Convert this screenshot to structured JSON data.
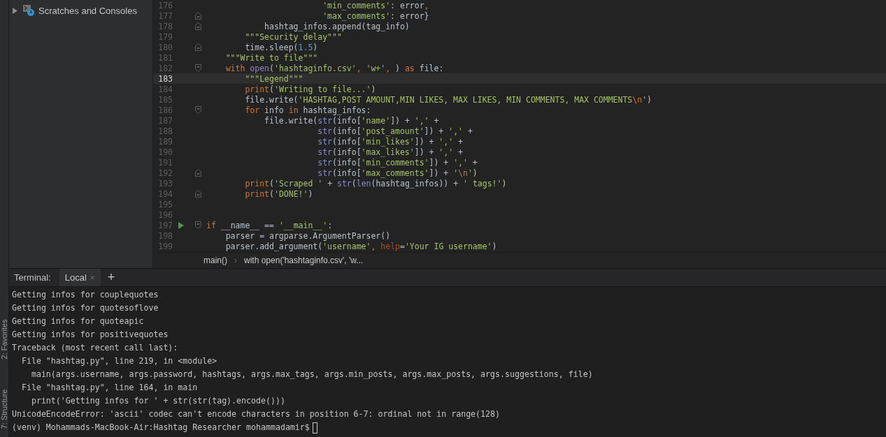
{
  "project_tree": {
    "items": [
      {
        "label": "Scratches and Consoles",
        "expanded": false
      }
    ]
  },
  "tool_strip": {
    "items": [
      {
        "label": "2: Favorites"
      },
      {
        "label": "7: Structure"
      }
    ]
  },
  "editor": {
    "lines": [
      {
        "number": "176",
        "fold_start": false,
        "fold_end": false,
        "run": false,
        "current": false,
        "tokens": [
          {
            "kind": "str",
            "text": "                        'min_comments'"
          },
          {
            "kind": "plain",
            "text": ": error"
          },
          {
            "kind": "kw",
            "text": ","
          }
        ]
      },
      {
        "number": "177",
        "fold_start": false,
        "fold_end": true,
        "run": false,
        "current": false,
        "tokens": [
          {
            "kind": "str",
            "text": "                        'max_comments'"
          },
          {
            "kind": "plain",
            "text": ": error}"
          }
        ]
      },
      {
        "number": "178",
        "fold_start": false,
        "fold_end": true,
        "run": false,
        "current": false,
        "tokens": [
          {
            "kind": "plain",
            "text": "            hashtag_infos.append(tag_info)"
          }
        ]
      },
      {
        "number": "179",
        "fold_start": false,
        "fold_end": false,
        "run": false,
        "current": false,
        "tokens": [
          {
            "kind": "doc",
            "text": "        \"\"\"Security delay\"\"\""
          }
        ]
      },
      {
        "number": "180",
        "fold_start": false,
        "fold_end": true,
        "run": false,
        "current": false,
        "tokens": [
          {
            "kind": "plain",
            "text": "        time.sleep("
          },
          {
            "kind": "num",
            "text": "1.5"
          },
          {
            "kind": "plain",
            "text": ")"
          }
        ]
      },
      {
        "number": "181",
        "fold_start": false,
        "fold_end": false,
        "run": false,
        "current": false,
        "tokens": [
          {
            "kind": "doc",
            "text": "    \"\"\"Write to file\"\"\""
          }
        ]
      },
      {
        "number": "182",
        "fold_start": true,
        "fold_end": false,
        "run": false,
        "current": false,
        "tokens": [
          {
            "kind": "kw",
            "text": "    with "
          },
          {
            "kind": "fn",
            "text": "open"
          },
          {
            "kind": "plain",
            "text": "("
          },
          {
            "kind": "str",
            "text": "'hashtaginfo.csv'"
          },
          {
            "kind": "kw",
            "text": ", "
          },
          {
            "kind": "str",
            "text": "'w+'"
          },
          {
            "kind": "kw",
            "text": ", "
          },
          {
            "kind": "plain",
            "text": ") "
          },
          {
            "kind": "kw",
            "text": "as "
          },
          {
            "kind": "plain",
            "text": "file:"
          }
        ]
      },
      {
        "number": "183",
        "fold_start": false,
        "fold_end": false,
        "run": false,
        "current": true,
        "tokens": [
          {
            "kind": "doc",
            "text": "        \"\"\"Legend\"\"\""
          }
        ]
      },
      {
        "number": "184",
        "fold_start": false,
        "fold_end": false,
        "run": false,
        "current": false,
        "tokens": [
          {
            "kind": "kw",
            "text": "        print"
          },
          {
            "kind": "plain",
            "text": "("
          },
          {
            "kind": "str",
            "text": "'Writing to file...'"
          },
          {
            "kind": "plain",
            "text": ")"
          }
        ]
      },
      {
        "number": "185",
        "fold_start": false,
        "fold_end": false,
        "run": false,
        "current": false,
        "tokens": [
          {
            "kind": "plain",
            "text": "        file.write("
          },
          {
            "kind": "str",
            "text": "'HASHTAG,POST AMOUNT,MIN LIKES, MAX LIKES, MIN COMMENTS, MAX COMMENTS"
          },
          {
            "kind": "esc",
            "text": "\\n"
          },
          {
            "kind": "str",
            "text": "'"
          },
          {
            "kind": "plain",
            "text": ")"
          }
        ]
      },
      {
        "number": "186",
        "fold_start": true,
        "fold_end": false,
        "run": false,
        "current": false,
        "tokens": [
          {
            "kind": "kw",
            "text": "        for "
          },
          {
            "kind": "plain",
            "text": "info "
          },
          {
            "kind": "kw",
            "text": "in "
          },
          {
            "kind": "plain",
            "text": "hashtag_infos:"
          }
        ]
      },
      {
        "number": "187",
        "fold_start": false,
        "fold_end": false,
        "run": false,
        "current": false,
        "tokens": [
          {
            "kind": "plain",
            "text": "            file.write("
          },
          {
            "kind": "fn",
            "text": "str"
          },
          {
            "kind": "plain",
            "text": "(info["
          },
          {
            "kind": "str",
            "text": "'name'"
          },
          {
            "kind": "plain",
            "text": "]) + "
          },
          {
            "kind": "str",
            "text": "','"
          },
          {
            "kind": "plain",
            "text": " +"
          }
        ]
      },
      {
        "number": "188",
        "fold_start": false,
        "fold_end": false,
        "run": false,
        "current": false,
        "tokens": [
          {
            "kind": "fn",
            "text": "                       str"
          },
          {
            "kind": "plain",
            "text": "(info["
          },
          {
            "kind": "str",
            "text": "'post_amount'"
          },
          {
            "kind": "plain",
            "text": "]) + "
          },
          {
            "kind": "str",
            "text": "','"
          },
          {
            "kind": "plain",
            "text": " +"
          }
        ]
      },
      {
        "number": "189",
        "fold_start": false,
        "fold_end": false,
        "run": false,
        "current": false,
        "tokens": [
          {
            "kind": "fn",
            "text": "                       str"
          },
          {
            "kind": "plain",
            "text": "(info["
          },
          {
            "kind": "str",
            "text": "'min_likes'"
          },
          {
            "kind": "plain",
            "text": "]) + "
          },
          {
            "kind": "str",
            "text": "','"
          },
          {
            "kind": "plain",
            "text": " +"
          }
        ]
      },
      {
        "number": "190",
        "fold_start": false,
        "fold_end": false,
        "run": false,
        "current": false,
        "tokens": [
          {
            "kind": "fn",
            "text": "                       str"
          },
          {
            "kind": "plain",
            "text": "(info["
          },
          {
            "kind": "str",
            "text": "'max_likes'"
          },
          {
            "kind": "plain",
            "text": "]) + "
          },
          {
            "kind": "str",
            "text": "','"
          },
          {
            "kind": "plain",
            "text": " +"
          }
        ]
      },
      {
        "number": "191",
        "fold_start": false,
        "fold_end": false,
        "run": false,
        "current": false,
        "tokens": [
          {
            "kind": "fn",
            "text": "                       str"
          },
          {
            "kind": "plain",
            "text": "(info["
          },
          {
            "kind": "str",
            "text": "'min_comments'"
          },
          {
            "kind": "plain",
            "text": "]) + "
          },
          {
            "kind": "str",
            "text": "','"
          },
          {
            "kind": "plain",
            "text": " +"
          }
        ]
      },
      {
        "number": "192",
        "fold_start": false,
        "fold_end": true,
        "run": false,
        "current": false,
        "tokens": [
          {
            "kind": "fn",
            "text": "                       str"
          },
          {
            "kind": "plain",
            "text": "(info["
          },
          {
            "kind": "str",
            "text": "'max_comments'"
          },
          {
            "kind": "plain",
            "text": "]) + "
          },
          {
            "kind": "str",
            "text": "'"
          },
          {
            "kind": "esc",
            "text": "\\n"
          },
          {
            "kind": "str",
            "text": "'"
          },
          {
            "kind": "plain",
            "text": ")"
          }
        ]
      },
      {
        "number": "193",
        "fold_start": false,
        "fold_end": false,
        "run": false,
        "current": false,
        "tokens": [
          {
            "kind": "kw",
            "text": "        print"
          },
          {
            "kind": "plain",
            "text": "("
          },
          {
            "kind": "str",
            "text": "'Scraped '"
          },
          {
            "kind": "plain",
            "text": " + "
          },
          {
            "kind": "fn",
            "text": "str"
          },
          {
            "kind": "plain",
            "text": "("
          },
          {
            "kind": "fn",
            "text": "len"
          },
          {
            "kind": "plain",
            "text": "(hashtag_infos)) + "
          },
          {
            "kind": "str",
            "text": "' tags!'"
          },
          {
            "kind": "plain",
            "text": ")"
          }
        ]
      },
      {
        "number": "194",
        "fold_start": false,
        "fold_end": true,
        "run": false,
        "current": false,
        "tokens": [
          {
            "kind": "kw",
            "text": "        print"
          },
          {
            "kind": "plain",
            "text": "("
          },
          {
            "kind": "str",
            "text": "'DONE!'"
          },
          {
            "kind": "plain",
            "text": ")"
          }
        ]
      },
      {
        "number": "195",
        "fold_start": false,
        "fold_end": false,
        "run": false,
        "current": false
      },
      {
        "number": "196",
        "fold_start": false,
        "fold_end": false,
        "run": false,
        "current": false
      },
      {
        "number": "197",
        "fold_start": true,
        "fold_end": false,
        "run": true,
        "current": false,
        "tokens": [
          {
            "kind": "kw",
            "text": "if "
          },
          {
            "kind": "plain",
            "text": "__name__ == "
          },
          {
            "kind": "str",
            "text": "'__main__'"
          },
          {
            "kind": "plain",
            "text": ":"
          }
        ]
      },
      {
        "number": "198",
        "fold_start": false,
        "fold_end": false,
        "run": false,
        "current": false,
        "tokens": [
          {
            "kind": "plain",
            "text": "    parser = argparse.ArgumentParser()"
          }
        ]
      },
      {
        "number": "199",
        "fold_start": false,
        "fold_end": false,
        "run": false,
        "current": false,
        "tokens": [
          {
            "kind": "plain",
            "text": "    parser.add_argument("
          },
          {
            "kind": "str",
            "text": "'username'"
          },
          {
            "kind": "kw",
            "text": ", "
          },
          {
            "kind": "param",
            "text": "help"
          },
          {
            "kind": "plain",
            "text": "="
          },
          {
            "kind": "str",
            "text": "'Your IG username'"
          },
          {
            "kind": "plain",
            "text": ")"
          }
        ]
      }
    ]
  },
  "breadcrumbs": [
    {
      "label": "main()"
    },
    {
      "label": "with open('hashtaginfo.csv', 'w..."
    }
  ],
  "breadcrumb_separator": "›",
  "terminal": {
    "title": "Terminal:",
    "tabs": [
      {
        "label": "Local",
        "close": "×",
        "selected": true
      }
    ],
    "add_button": "+",
    "lines": [
      "Getting infos for couplequotes",
      "Getting infos for quotesoflove",
      "Getting infos for quoteapic",
      "Getting infos for positivequotes",
      "Traceback (most recent call last):",
      "  File \"hashtag.py\", line 219, in <module>",
      "    main(args.username, args.password, hashtags, args.max_tags, args.min_posts, args.max_posts, args.suggestions, file)",
      "  File \"hashtag.py\", line 164, in main",
      "    print('Getting infos for ' + str(str(tag).encode()))",
      "UnicodeEncodeError: 'ascii' codec can't encode characters in position 6-7: ordinal not in range(128)"
    ],
    "prompt": "(venv) Mohammads-MacBook-Air:Hashtag Researcher mohammadamir$"
  }
}
